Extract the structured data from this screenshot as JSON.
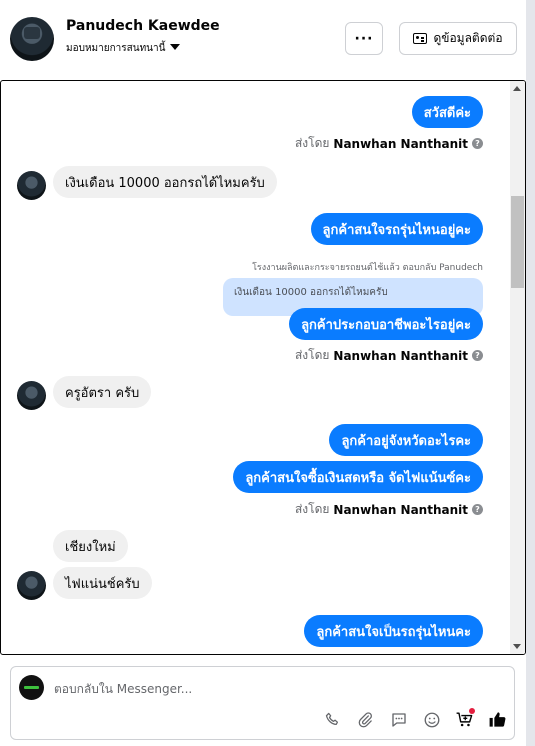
{
  "header": {
    "contact_name": "Panudech Kaewdee",
    "assign_label": "มอบหมายการสนทนานี้",
    "more_label": "···",
    "view_contact_label": "ดูข้อมูลติดต่อ"
  },
  "messages": {
    "m1": "สวัสดีค่ะ",
    "sent_by_prefix": "ส่งโดย",
    "sent_by_name": "Nanwhan Nanthanit",
    "m2": "เงินเดือน 10000 ออกรถได้ไหมครับ",
    "m3": "ลูกค้าสนใจรถรุ่นไหนอยู่คะ",
    "reply_note": "โรงงานผลิตและกระจายรถยนต์ไช้แล้ว ตอบกลับ Panudech",
    "quoted_text": "เงินเดือน 10000 ออกรถได้ไหมครับ",
    "m4": "ลูกค้าประกอบอาชีพอะไรอยู่คะ",
    "m5": "ครูอัตรา ครับ",
    "m6": "ลูกค้าอยู่จังหวัดอะไรคะ",
    "m7": "ลูกค้าสนใจซื้อเงินสดหรือ จัดไฟแน้นซ์คะ",
    "m8": "เชียงใหม่",
    "m9": "ไฟแน่นช์ครับ",
    "m10": "ลูกค้าสนใจเป็นรถรุ่นไหนคะ"
  },
  "composer": {
    "placeholder": "ตอบกลับใน Messenger..."
  },
  "icons": [
    "more-icon",
    "contact-card-icon",
    "help-icon",
    "phone-icon",
    "attach-icon",
    "saved-reply-icon",
    "emoji-icon",
    "cart-icon",
    "thumbs-up-icon"
  ],
  "colors": {
    "outgoing_bubble": "#0a7cff",
    "incoming_bubble": "#f0f0f0",
    "quoted_bubble": "#cfe3ff",
    "notification_dot": "#e41e3f"
  }
}
